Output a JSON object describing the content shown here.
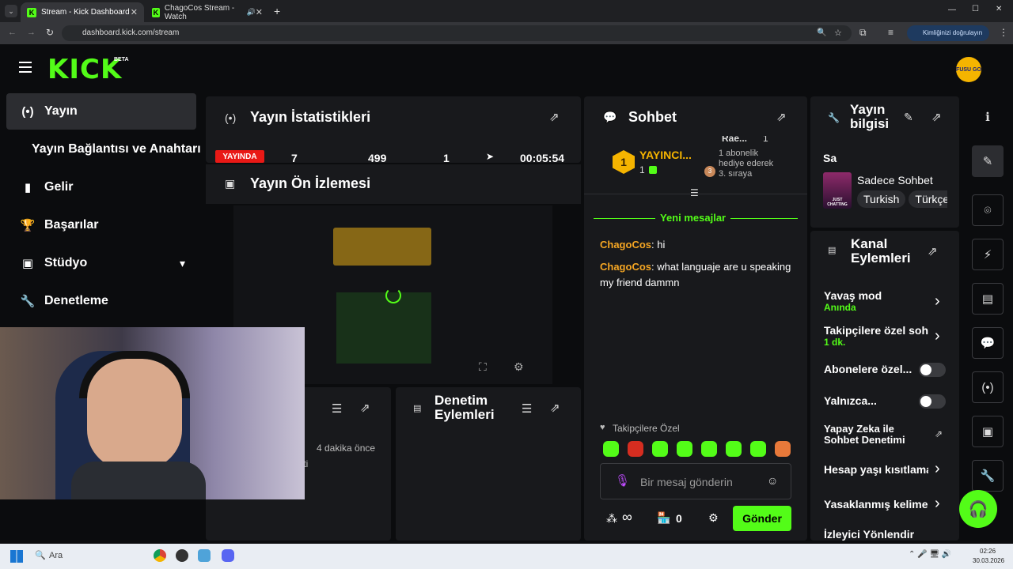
{
  "browser": {
    "tabs": [
      {
        "label": "Stream - Kick Dashboard",
        "close": "✕"
      },
      {
        "label": "ChagoCos Stream - Watch",
        "close": "✕"
      }
    ],
    "new_tab": "+",
    "url": "dashboard.kick.com/stream",
    "identity_button": "Kimliğinizi doğrulayın",
    "window_controls": [
      "—",
      "☐",
      "✕"
    ]
  },
  "header": {
    "logo": "KICK",
    "beta": "BETA",
    "avatar_text": "FUSU GO"
  },
  "sidebar": {
    "items": [
      {
        "label": "Yayın",
        "icon": "(•)"
      },
      {
        "label": "Yayın Bağlantısı ve Anahtarı",
        "icon": ""
      },
      {
        "label": "Gelir",
        "icon": "▮"
      },
      {
        "label": "Başarılar",
        "icon": "🏆"
      },
      {
        "label": "Stüdyo",
        "icon": "▣"
      },
      {
        "label": "Denetleme",
        "icon": "🔧"
      }
    ]
  },
  "stats": {
    "title": "Yayın İstatistikleri",
    "live_badge": "YAYINDA",
    "values": [
      "7",
      "499",
      "1",
      "00:05:54"
    ]
  },
  "preview": {
    "title": "Yayın Ön İzlemesi"
  },
  "activity": {
    "time": "4 dakika önce",
    "text": "tti"
  },
  "moderation": {
    "title": "Denetim Eylemleri"
  },
  "chat": {
    "title": "Sohbet",
    "leaderboard": {
      "rank": "1",
      "name": "YAYINCI...",
      "count": "1",
      "right_name": "Rae...",
      "right_count": "1",
      "right_text": "1 abonelik hediye ederek 3. sıraya"
    },
    "new_messages": "Yeni mesajlar",
    "messages": [
      {
        "user": "ChagoCos",
        "text": "hi"
      },
      {
        "user": "ChagoCos",
        "text": "what languaje are u speaking my friend dammn"
      }
    ],
    "followers_only": "Takipçilere Özel",
    "input_placeholder": "Bir mesaj gönderin",
    "points": "∞",
    "store_count": "0",
    "send_label": "Gönder"
  },
  "stream_info": {
    "title": "Yayın bilgisi",
    "stream_title": "Sa",
    "category": "Sadece Sohbet",
    "category_thumb": "JUST CHATTING",
    "tags": [
      "Turkish",
      "Türkçe"
    ]
  },
  "channel_actions": {
    "title": "Kanal Eylemleri",
    "items": [
      {
        "label": "Yavaş mod",
        "sub": "Anında",
        "control": "chevron"
      },
      {
        "label": "Takipçilere özel sohbet",
        "sub": "1 dk.",
        "control": "chevron"
      },
      {
        "label": "Abonelere özel...",
        "sub": "",
        "control": "toggle"
      },
      {
        "label": "Yalnızca...",
        "sub": "",
        "control": "toggle"
      },
      {
        "label": "Yapay Zeka ile Sohbet Denetimi",
        "sub": "",
        "control": "external"
      },
      {
        "label": "Hesap yaşı kısıtlaması",
        "sub": "",
        "control": "chevron"
      },
      {
        "label": "Yasaklanmış kelimeler",
        "sub": "",
        "control": "chevron"
      },
      {
        "label": "İzleyici Yönlendir",
        "sub": "",
        "control": "none"
      }
    ]
  },
  "taskbar": {
    "search": "Ara",
    "time": "02:26",
    "date": "30.03.2026"
  },
  "colors": {
    "brand": "#53fc18",
    "live": "#e91916",
    "panel": "#18191c",
    "username": "#f5a623",
    "gold": "#f5b400"
  }
}
